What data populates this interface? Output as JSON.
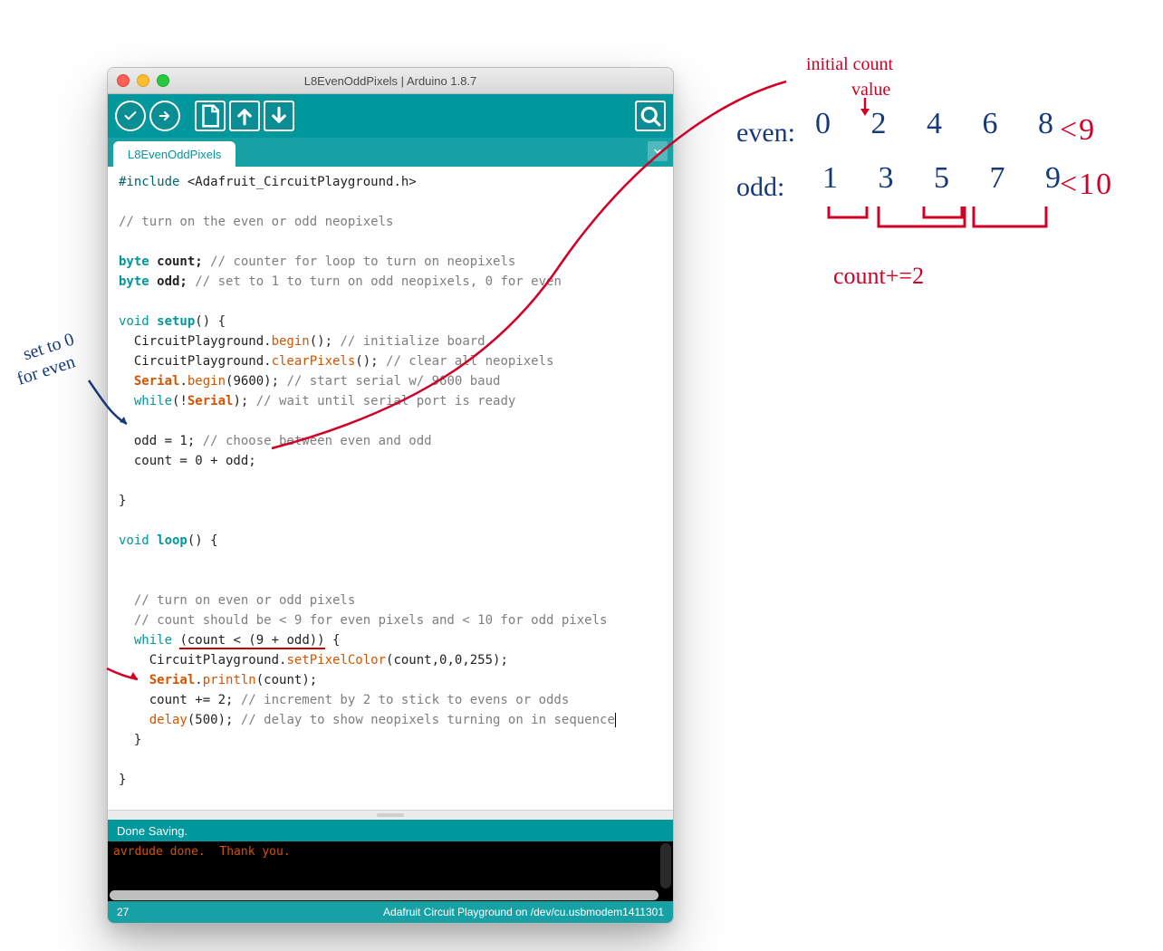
{
  "window": {
    "title": "L8EvenOddPixels | Arduino 1.8.7",
    "tab_label": "L8EvenOddPixels"
  },
  "toolbar": {
    "verify_tip": "Verify",
    "upload_tip": "Upload",
    "new_tip": "New",
    "open_tip": "Open",
    "save_tip": "Save",
    "serial_tip": "Serial Monitor"
  },
  "code": {
    "l1a": "#include",
    "l1b": " <Adafruit_CircuitPlayground.h>",
    "l3": "// turn on the even or odd neopixels",
    "l5a": "byte",
    "l5b": " count; ",
    "l5c": "// counter for loop to turn on neopixels",
    "l6a": "byte",
    "l6b": " odd; ",
    "l6c": "// set to 1 to turn on odd neopixels, 0 for even",
    "l8a": "void",
    "l8b": " setup",
    "l8c": "() {",
    "l9a": "  CircuitPlayground.",
    "l9b": "begin",
    "l9c": "(); ",
    "l9d": "// initialize board",
    "l10a": "  CircuitPlayground.",
    "l10b": "clearPixels",
    "l10c": "(); ",
    "l10d": "// clear all neopixels",
    "l11a": "  ",
    "l11b": "Serial",
    "l11c": ".",
    "l11d": "begin",
    "l11e": "(9600); ",
    "l11f": "// start serial w/ 9600 baud",
    "l12a": "  ",
    "l12b": "while",
    "l12c": "(!",
    "l12d": "Serial",
    "l12e": "); ",
    "l12f": "// wait until serial port is ready",
    "l14a": "  odd = 1; ",
    "l14b": "// choose between even and odd",
    "l15": "  count = 0 + odd;",
    "l17": "}",
    "l19a": "void",
    "l19b": " loop",
    "l19c": "() {",
    "l22": "  // turn on even or odd pixels",
    "l23": "  // count should be < 9 for even pixels and < 10 for odd pixels",
    "l24a": "  ",
    "l24b": "while",
    "l24c": " ",
    "l24d": "(count < (9 + odd))",
    "l24e": " {",
    "l25a": "    CircuitPlayground.",
    "l25b": "setPixelColor",
    "l25c": "(count,0,0,255);",
    "l26a": "    ",
    "l26b": "Serial",
    "l26c": ".",
    "l26d": "println",
    "l26e": "(count);",
    "l27a": "    count += 2; ",
    "l27b": "// increment by 2 to stick to evens or odds",
    "l28a": "    ",
    "l28b": "delay",
    "l28c": "(500); ",
    "l28d": "// delay to show neopixels turning on in sequence",
    "l29": "  }",
    "l31": "}"
  },
  "status": {
    "text": "Done Saving."
  },
  "console": {
    "line1": "avrdude done.  Thank you."
  },
  "footer": {
    "line": "27",
    "board": "Adafruit Circuit Playground on /dev/cu.usbmodem1411301"
  },
  "annotations": {
    "setto": "set to 0",
    "forever": "for even",
    "initial": "initial count",
    "value": "value",
    "even_label": "even:",
    "even_nums": "0 2 4 6 8",
    "even_cond": "<9",
    "odd_label": "odd:",
    "odd_nums": "1 3 5 7 9",
    "odd_cond": "<10",
    "increment": "count+=2"
  }
}
